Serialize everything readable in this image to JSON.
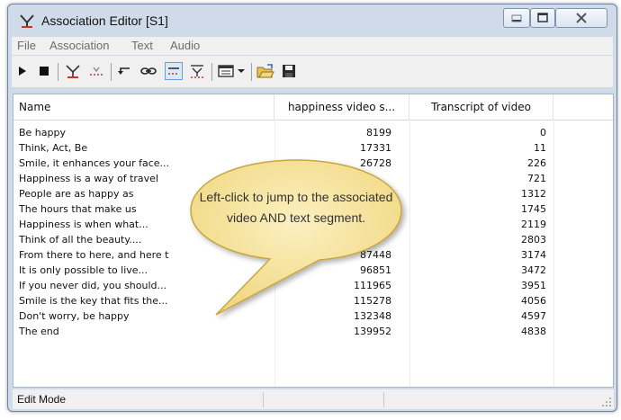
{
  "window": {
    "title": "Association Editor [S1]",
    "controls": [
      "minimize",
      "maximize",
      "close"
    ]
  },
  "menu": [
    "File",
    "Association",
    "Text",
    "Audio"
  ],
  "toolbar": {
    "icons": [
      "play-icon",
      "stop-icon",
      "association-icon",
      "split-icon",
      "undo-icon",
      "link-icon",
      "segment-icon",
      "merge-icon",
      "grid-icon",
      "dropdown-arrow-icon",
      "open-folder-icon",
      "save-icon"
    ]
  },
  "table": {
    "columns": [
      "Name",
      "happiness video s...",
      "Transcript of video"
    ],
    "rows": [
      {
        "name": "Be happy",
        "video": "8199",
        "transcript": "0"
      },
      {
        "name": "Think, Act, Be",
        "video": "17331",
        "transcript": "11"
      },
      {
        "name": "Smile, it enhances your face...",
        "video": "26728",
        "transcript": "226"
      },
      {
        "name": "Happiness is a way of travel",
        "video": "",
        "transcript": "721"
      },
      {
        "name": "People are as happy as",
        "video": "",
        "transcript": "1312"
      },
      {
        "name": "The hours that make us",
        "video": "",
        "transcript": "1745"
      },
      {
        "name": "Happiness is when what...",
        "video": "",
        "transcript": "2119"
      },
      {
        "name": "Think of all the beauty....",
        "video": "",
        "transcript": "2803"
      },
      {
        "name": "From there to here, and here t",
        "video": "87448",
        "transcript": "3174"
      },
      {
        "name": "It is only possible to live...",
        "video": "96851",
        "transcript": "3472"
      },
      {
        "name": "If you never did, you should...",
        "video": "111965",
        "transcript": "3951"
      },
      {
        "name": "Smile is the key that fits the...",
        "video": "115278",
        "transcript": "4056"
      },
      {
        "name": "Don't worry, be happy",
        "video": "132348",
        "transcript": "4597"
      },
      {
        "name": "The end",
        "video": "139952",
        "transcript": "4838"
      }
    ]
  },
  "status": {
    "mode": "Edit Mode"
  },
  "callout": {
    "text": "Left-click to jump to the associated video AND text segment."
  },
  "colors": {
    "titlebar": "#cfdbe9",
    "callout_fill": "#f4e29a",
    "callout_border": "#c9a43f",
    "icon_red": "#c0392b"
  }
}
